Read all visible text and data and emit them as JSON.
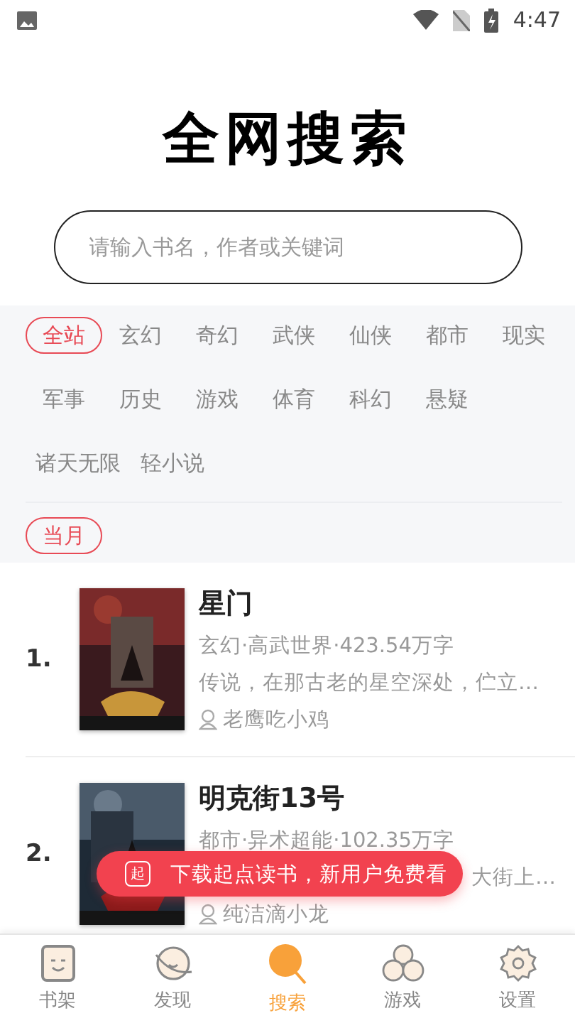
{
  "status_bar": {
    "time": "4:47"
  },
  "title": "全网搜索",
  "search": {
    "placeholder": "请输入书名，作者或关键词"
  },
  "categories": [
    {
      "label": "全站",
      "selected": true
    },
    {
      "label": "玄幻",
      "selected": false
    },
    {
      "label": "奇幻",
      "selected": false
    },
    {
      "label": "武侠",
      "selected": false
    },
    {
      "label": "仙侠",
      "selected": false
    },
    {
      "label": "都市",
      "selected": false
    },
    {
      "label": "现实",
      "selected": false
    },
    {
      "label": "军事",
      "selected": false
    },
    {
      "label": "历史",
      "selected": false
    },
    {
      "label": "游戏",
      "selected": false
    },
    {
      "label": "体育",
      "selected": false
    },
    {
      "label": "科幻",
      "selected": false
    },
    {
      "label": "悬疑",
      "selected": false
    },
    {
      "label": "诸天无限",
      "selected": false
    },
    {
      "label": "轻小说",
      "selected": false
    }
  ],
  "periods": [
    {
      "label": "当月",
      "selected": true
    }
  ],
  "books": [
    {
      "rank": "1.",
      "title": "星门",
      "meta": "玄幻·高武世界·423.54万字",
      "desc": "传说，在那古老的星空深处，伫立…",
      "desc_cut": false,
      "author": "老鹰吃小鸡"
    },
    {
      "rank": "2.",
      "title": "明克街13号",
      "meta": "都市·异术超能·102.35万字",
      "desc": "大街上…",
      "desc_cut": true,
      "author": "纯洁滴小龙"
    }
  ],
  "toast": {
    "icon_text": "起",
    "text": "下载起点读书，新用户免费看"
  },
  "nav": [
    {
      "label": "书架",
      "kind": "shelf",
      "selected": false
    },
    {
      "label": "发现",
      "kind": "planet",
      "selected": false
    },
    {
      "label": "搜索",
      "kind": "search",
      "selected": true
    },
    {
      "label": "游戏",
      "kind": "game",
      "selected": false
    },
    {
      "label": "设置",
      "kind": "settings",
      "selected": false
    }
  ]
}
